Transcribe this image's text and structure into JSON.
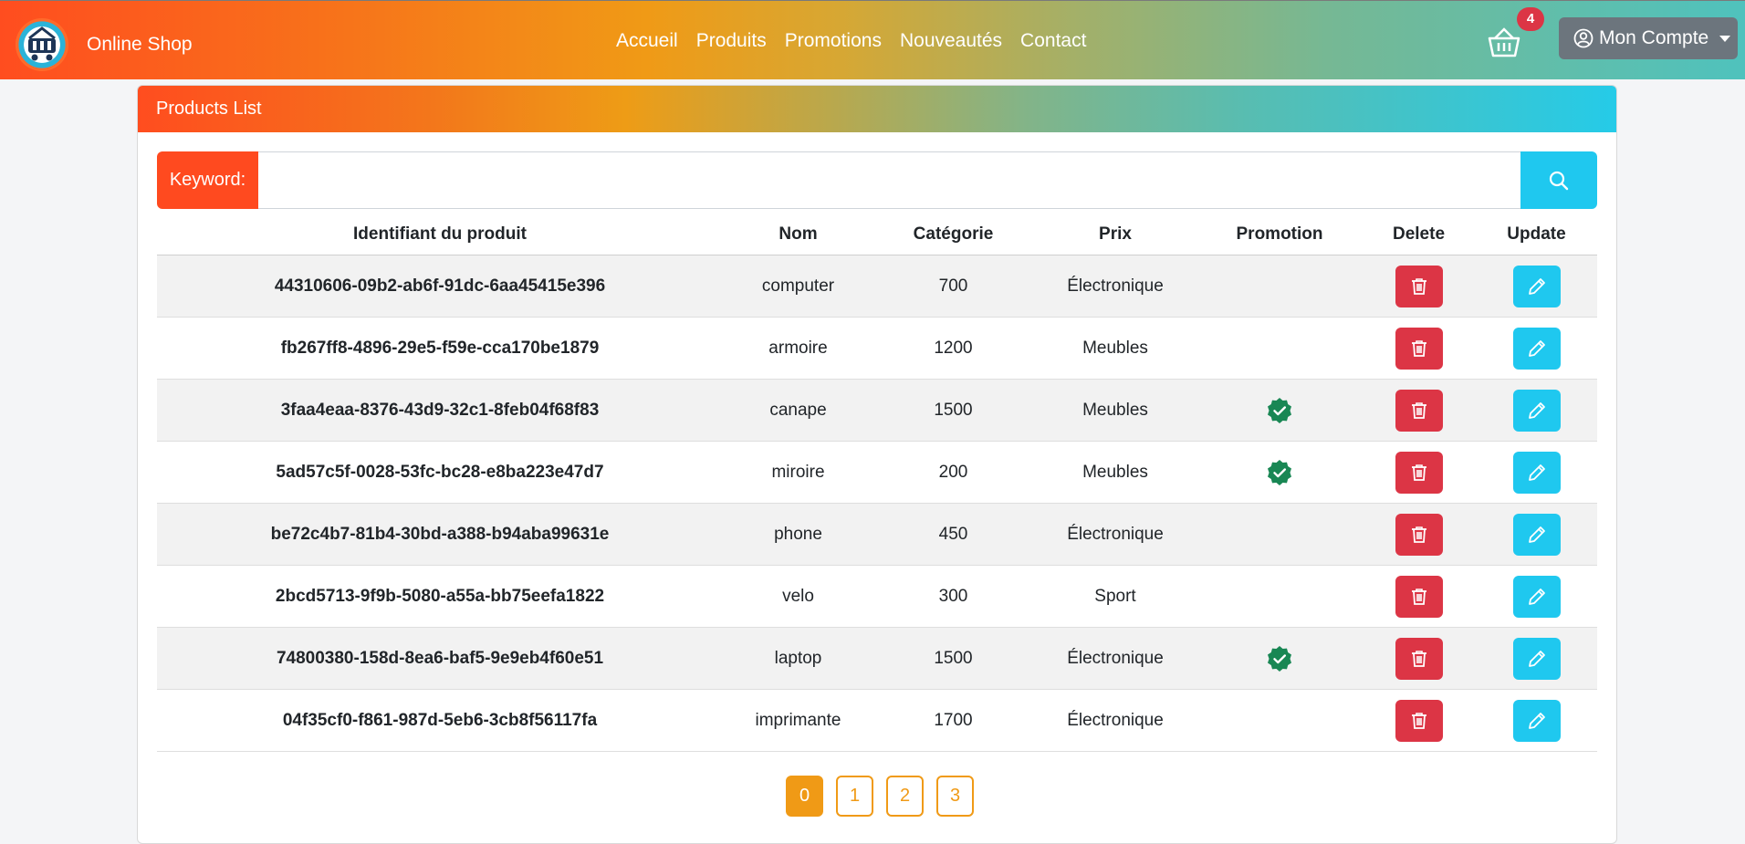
{
  "brand": {
    "name": "Online Shop"
  },
  "nav": [
    "Accueil",
    "Produits",
    "Promotions",
    "Nouveautés",
    "Contact"
  ],
  "cart": {
    "count": "4"
  },
  "account": {
    "label": "Mon Compte"
  },
  "card": {
    "title": "Products List"
  },
  "search": {
    "label": "Keyword:",
    "value": "",
    "placeholder": ""
  },
  "table": {
    "headers": [
      "Identifiant du produit",
      "Nom",
      "Catégorie",
      "Prix",
      "Promotion",
      "Delete",
      "Update"
    ],
    "rows": [
      {
        "id": "44310606-09b2-ab6f-91dc-6aa45415e396",
        "nom": "computer",
        "categorie": "700",
        "prix": "Électronique",
        "promotion": false
      },
      {
        "id": "fb267ff8-4896-29e5-f59e-cca170be1879",
        "nom": "armoire",
        "categorie": "1200",
        "prix": "Meubles",
        "promotion": false
      },
      {
        "id": "3faa4eaa-8376-43d9-32c1-8feb04f68f83",
        "nom": "canape",
        "categorie": "1500",
        "prix": "Meubles",
        "promotion": true
      },
      {
        "id": "5ad57c5f-0028-53fc-bc28-e8ba223e47d7",
        "nom": "miroire",
        "categorie": "200",
        "prix": "Meubles",
        "promotion": true
      },
      {
        "id": "be72c4b7-81b4-30bd-a388-b94aba99631e",
        "nom": "phone",
        "categorie": "450",
        "prix": "Électronique",
        "promotion": false
      },
      {
        "id": "2bcd5713-9f9b-5080-a55a-bb75eefa1822",
        "nom": "velo",
        "categorie": "300",
        "prix": "Sport",
        "promotion": false
      },
      {
        "id": "74800380-158d-8ea6-baf5-9e9eb4f60e51",
        "nom": "laptop",
        "categorie": "1500",
        "prix": "Électronique",
        "promotion": true
      },
      {
        "id": "04f35cf0-f861-987d-5eb6-3cb8f56117fa",
        "nom": "imprimante",
        "categorie": "1700",
        "prix": "Électronique",
        "promotion": false
      }
    ]
  },
  "pagination": {
    "pages": [
      "0",
      "1",
      "2",
      "3"
    ],
    "current": "0"
  },
  "colors": {
    "accent_orange": "#f09a16",
    "danger": "#dc3545",
    "info": "#1fc8ef",
    "promo_badge": "#198754"
  },
  "icons": {
    "logo": "shopping-basket-logo-icon",
    "cart": "cart-icon",
    "account": "user-circle-icon",
    "search": "search-icon",
    "delete": "trash-icon",
    "update": "pencil-icon",
    "promotion": "verified-check-icon"
  }
}
